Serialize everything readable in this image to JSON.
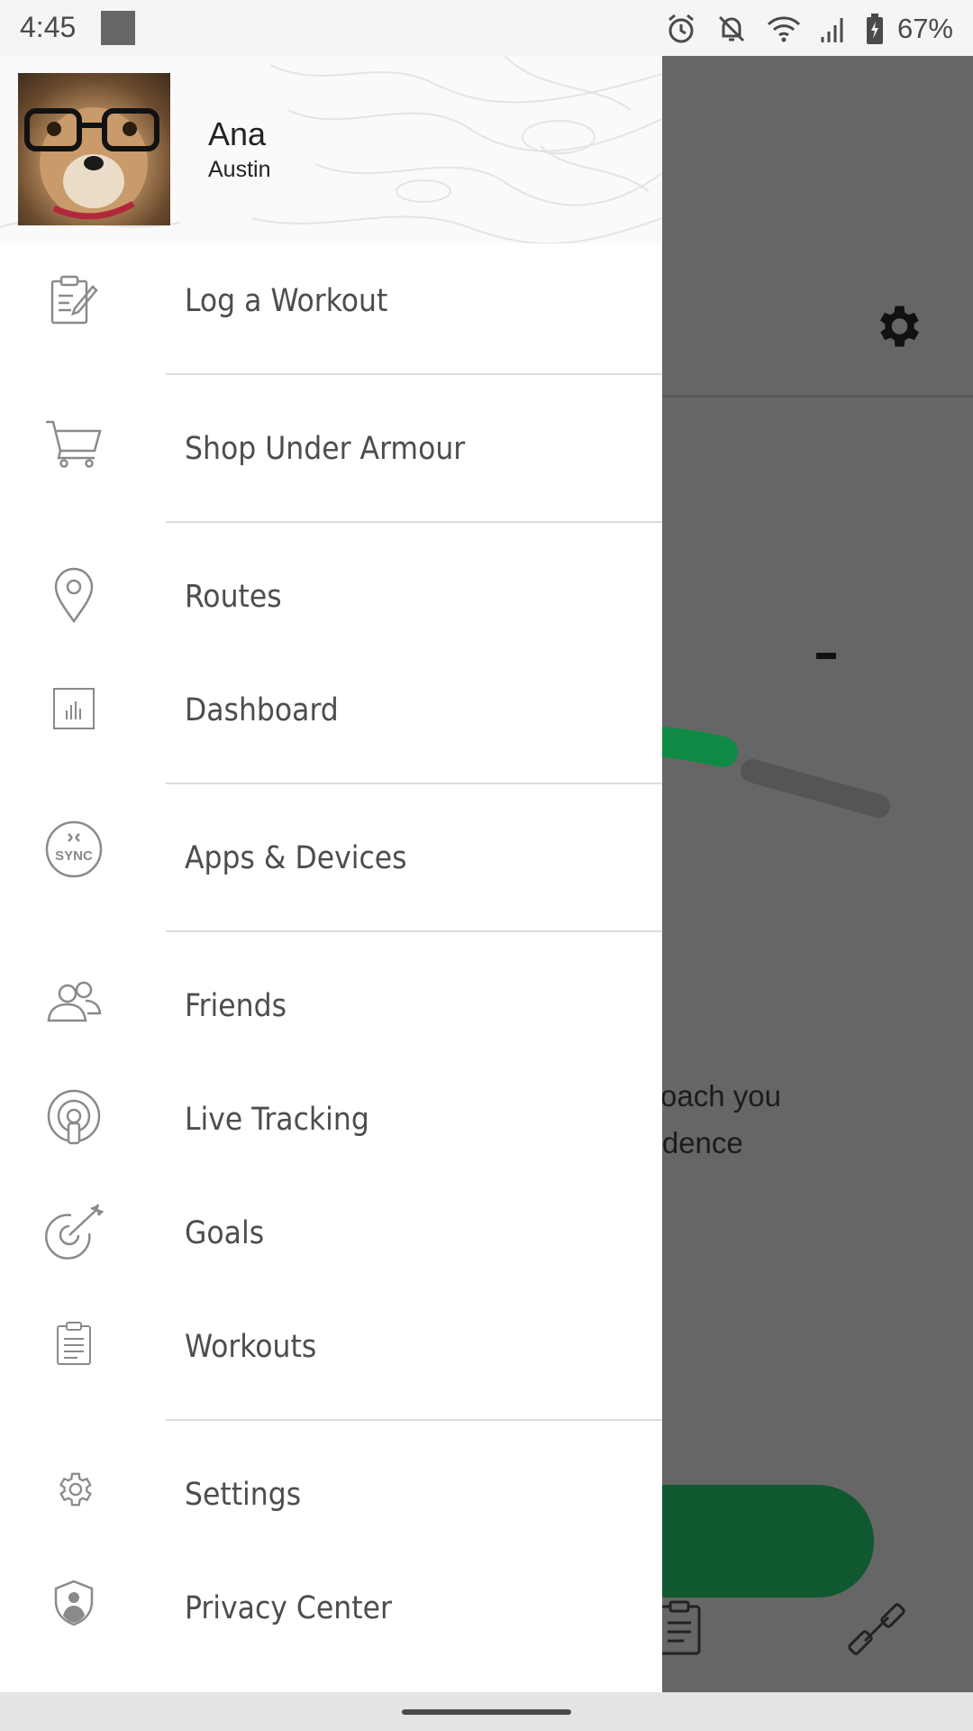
{
  "status_bar": {
    "time": "4:45",
    "battery": "67%",
    "icons": [
      "alarm-icon",
      "bell-off-icon",
      "wifi-icon",
      "signal-icon",
      "battery-icon"
    ]
  },
  "profile": {
    "name": "Ana",
    "city": "Austin"
  },
  "menu": [
    {
      "label": "Log a Workout",
      "icon": "log-workout-icon"
    },
    {
      "label": "Shop Under Armour",
      "icon": "cart-icon"
    },
    {
      "label": "Routes",
      "icon": "location-pin-icon"
    },
    {
      "label": "Dashboard",
      "icon": "dashboard-chart-icon"
    },
    {
      "label": "Apps & Devices",
      "icon": "sync-icon",
      "icon_text": "SYNC"
    },
    {
      "label": "Friends",
      "icon": "friends-icon"
    },
    {
      "label": "Live Tracking",
      "icon": "live-tracking-icon"
    },
    {
      "label": "Goals",
      "icon": "goals-target-icon"
    },
    {
      "label": "Workouts",
      "icon": "workouts-clipboard-icon"
    },
    {
      "label": "Settings",
      "icon": "gear-icon"
    },
    {
      "label": "Privacy Center",
      "icon": "privacy-shield-icon"
    }
  ],
  "background_screen": {
    "text_line_1": "l coach you",
    "text_line_2": "cadence"
  },
  "colors": {
    "accent_green": "#10582f",
    "progress_green": "#0e8a45",
    "scrim": "#666666"
  }
}
